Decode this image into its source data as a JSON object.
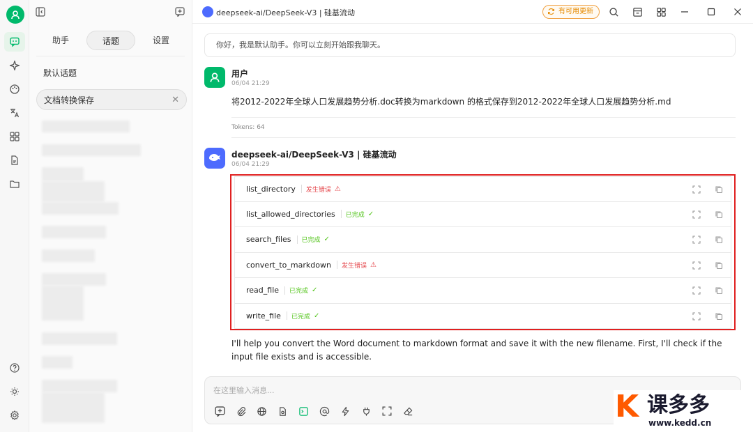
{
  "app": {
    "title": "deepseek-ai/DeepSeek-V3 | 硅基流动",
    "update_label": "有可用更新",
    "colors": {
      "accent": "#00b96b",
      "update": "#e68a00",
      "error": "#e5484d",
      "success": "#52c41a",
      "highlight_box": "#e02020"
    }
  },
  "rail": {
    "icons": [
      "user-avatar-icon",
      "chat-icon",
      "sparkle-icon",
      "palette-icon",
      "translate-icon",
      "apps-grid-icon",
      "document-icon",
      "folder-icon",
      "help-icon",
      "brightness-icon",
      "settings-icon"
    ]
  },
  "panel": {
    "tabs": [
      "助手",
      "话题",
      "设置"
    ],
    "active_tab": "话题",
    "topics": [
      {
        "label": "默认话题"
      },
      {
        "label": "文档转换保存",
        "selected": true
      }
    ]
  },
  "chat": {
    "greeting": "你好，我是默认助手。你可以立刻开始跟我聊天。",
    "user_message": {
      "name": "用户",
      "time": "06/04 21:29",
      "text": "将2012-2022年全球人口发展趋势分析.doc转换为markdown 的格式保存到2012-2022年全球人口发展趋势分析.md",
      "tokens": "Tokens: 64"
    },
    "assistant_message": {
      "name": "deepseek-ai/DeepSeek-V3 | 硅基流动",
      "time": "06/04 21:29",
      "tool_calls": [
        {
          "name": "list_directory",
          "status": "发生错误",
          "state": "error",
          "mark": "⚠"
        },
        {
          "name": "list_allowed_directories",
          "status": "已完成",
          "state": "ok",
          "mark": "✓"
        },
        {
          "name": "search_files",
          "status": "已完成",
          "state": "ok",
          "mark": "✓"
        },
        {
          "name": "convert_to_markdown",
          "status": "发生错误",
          "state": "error",
          "mark": "⚠"
        },
        {
          "name": "read_file",
          "status": "已完成",
          "state": "ok",
          "mark": "✓"
        },
        {
          "name": "write_file",
          "status": "已完成",
          "state": "ok",
          "mark": "✓"
        }
      ],
      "reply": "I'll help you convert the Word document to markdown format and save it with the new filename. First, I'll check if the input file exists and is accessible."
    }
  },
  "input": {
    "placeholder": "在这里输入消息...",
    "toolbar_icons": [
      "new-topic-icon",
      "attachment-icon",
      "globe-icon",
      "knowledge-icon",
      "mcp-icon",
      "mention-icon",
      "lightning-icon",
      "plug-icon",
      "fullscreen-icon",
      "eraser-icon"
    ]
  },
  "watermark": {
    "brand": "课多多",
    "url": "www.kedd.cn"
  }
}
